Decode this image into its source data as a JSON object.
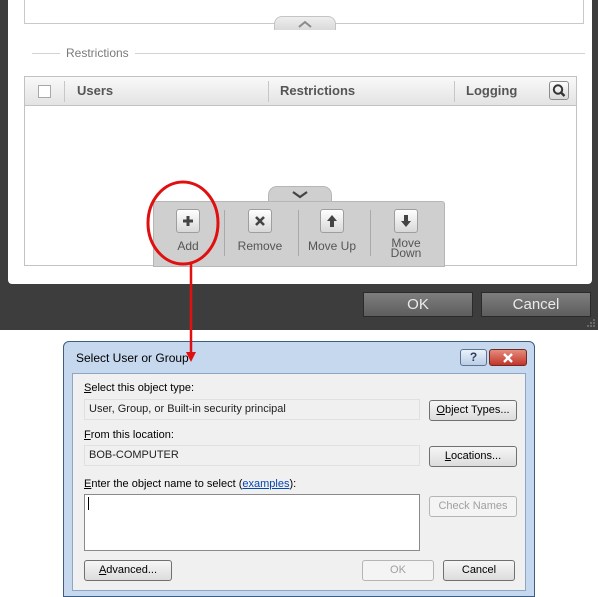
{
  "settings_window": {
    "section_label": "Restrictions",
    "table": {
      "columns": [
        "Users",
        "Restrictions",
        "Logging"
      ],
      "rows": []
    },
    "toolbar": {
      "add": "Add",
      "remove": "Remove",
      "move_up": "Move Up",
      "move_down_line1": "Move",
      "move_down_line2": "Down"
    },
    "ok_label": "OK",
    "cancel_label": "Cancel"
  },
  "dialog": {
    "title": "Select User or Group",
    "help_symbol": "?",
    "object_type_label_key": "S",
    "object_type_label_rest": "elect this object type:",
    "object_type_value": "User, Group, or Built-in security principal",
    "object_types_button_key": "O",
    "object_types_button_rest": "bject Types...",
    "location_label_key": "F",
    "location_label_rest": "rom this location:",
    "location_value": "BOB-COMPUTER",
    "locations_button_key": "L",
    "locations_button_rest": "ocations...",
    "enter_label_key": "E",
    "enter_label_rest": "nter the object name to select (",
    "enter_label_link": "examples",
    "enter_label_end": "):",
    "object_name_value": "",
    "check_names_button": "Check Names",
    "advanced_button_key": "A",
    "advanced_button_rest": "dvanced...",
    "ok_button": "OK",
    "cancel_button": "Cancel"
  },
  "colors": {
    "annotation": "#e01010",
    "dark_background": "#3d3d3d",
    "dialog_frame": "#c5d8ee",
    "link": "#0645ad"
  }
}
